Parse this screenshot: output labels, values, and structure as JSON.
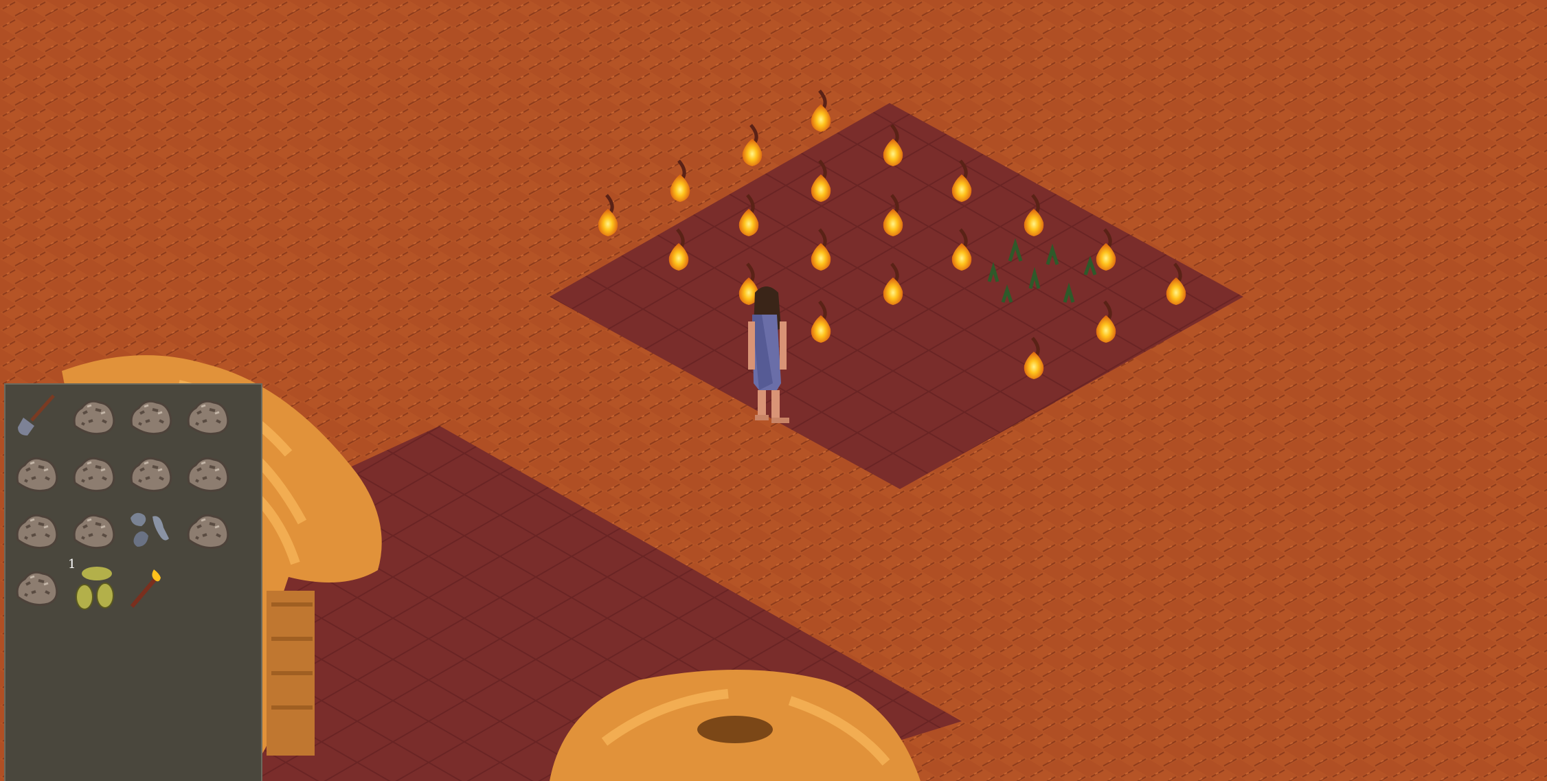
{
  "scene": {
    "ground_color": "#b04f24",
    "tilled_color": "#7a2b2a",
    "torch_count": 21,
    "player": {
      "description_icon": "player-character-icon"
    },
    "crop": {
      "icon": "grass-sprout-icon"
    }
  },
  "inventory": {
    "slots": [
      {
        "icon": "shovel-icon",
        "count": ""
      },
      {
        "icon": "rock-icon",
        "count": ""
      },
      {
        "icon": "rock-icon",
        "count": ""
      },
      {
        "icon": "rock-icon",
        "count": ""
      },
      {
        "icon": "rock-icon",
        "count": ""
      },
      {
        "icon": "rock-icon",
        "count": ""
      },
      {
        "icon": "rock-icon",
        "count": ""
      },
      {
        "icon": "rock-icon",
        "count": ""
      },
      {
        "icon": "rock-icon",
        "count": ""
      },
      {
        "icon": "rock-icon",
        "count": ""
      },
      {
        "icon": "flint-stones-icon",
        "count": ""
      },
      {
        "icon": "rock-icon",
        "count": ""
      },
      {
        "icon": "rock-icon",
        "count": ""
      },
      {
        "icon": "seeds-icon",
        "count": "1"
      },
      {
        "icon": "torch-icon",
        "count": ""
      }
    ]
  }
}
